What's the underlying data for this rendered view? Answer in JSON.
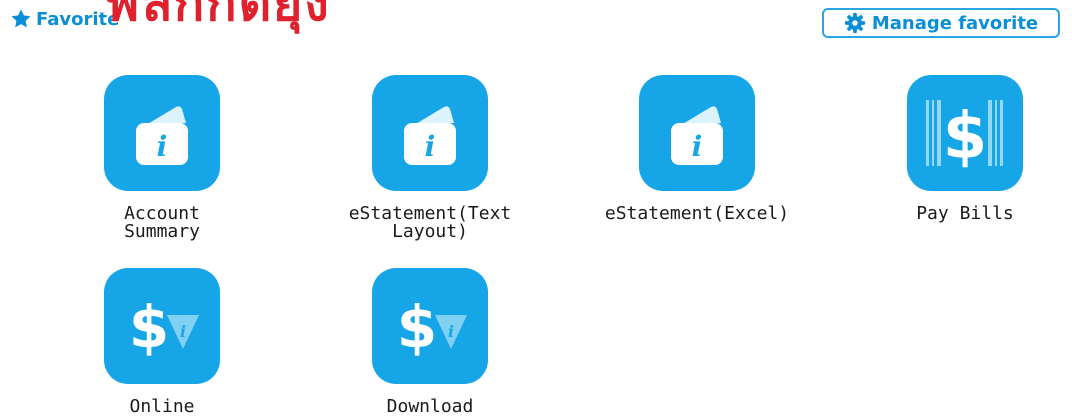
{
  "header": {
    "favorite_label": "Favorite",
    "overlay_text": "ฟิลกกิตยุง",
    "manage_label": "Manage favorite"
  },
  "tiles": [
    {
      "label": "Account\nSummary",
      "icon": "folder-info-icon"
    },
    {
      "label": "eStatement(Text\nLayout)",
      "icon": "folder-info-icon"
    },
    {
      "label": "eStatement(Excel)",
      "icon": "folder-info-icon"
    },
    {
      "label": "Pay Bills",
      "icon": "dollar-barcode-icon"
    },
    {
      "label": "Online",
      "icon": "dollar-info-icon"
    },
    {
      "label": "Download",
      "icon": "dollar-info-icon"
    }
  ],
  "colors": {
    "accent": "#16a6e8",
    "title_blue": "#0a8fd6",
    "overlay_red": "#e0212d"
  }
}
